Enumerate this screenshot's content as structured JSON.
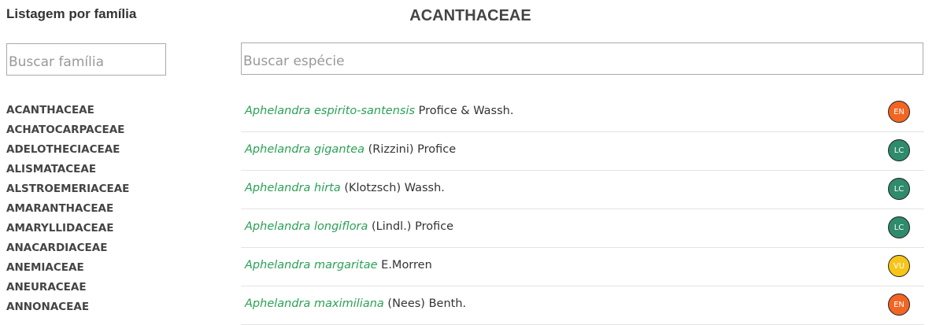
{
  "sidebar": {
    "title": "Listagem por família",
    "search_placeholder": "Buscar família",
    "families": [
      "ACANTHACEAE",
      "ACHATOCARPACEAE",
      "ADELOTHECIACEAE",
      "ALISMATACEAE",
      "ALSTROEMERIACEAE",
      "AMARANTHACEAE",
      "AMARYLLIDACEAE",
      "ANACARDIACEAE",
      "ANEMIACEAE",
      "ANEURACEAE",
      "ANNONACEAE"
    ]
  },
  "main": {
    "title": "ACANTHACEAE",
    "search_placeholder": "Buscar espécie",
    "species": [
      {
        "name": "Aphelandra espirito-santensis",
        "author": "Profice & Wassh.",
        "status": "EN",
        "status_color": "#f26522"
      },
      {
        "name": "Aphelandra gigantea",
        "author": "(Rizzini) Profice",
        "status": "LC",
        "status_color": "#2e8b6b"
      },
      {
        "name": "Aphelandra hirta",
        "author": "(Klotzsch) Wassh.",
        "status": "LC",
        "status_color": "#2e8b6b"
      },
      {
        "name": "Aphelandra longiflora",
        "author": "(Lindl.) Profice",
        "status": "LC",
        "status_color": "#2e8b6b"
      },
      {
        "name": "Aphelandra margaritae",
        "author": "E.Morren",
        "status": "VU",
        "status_color": "#f5c518"
      },
      {
        "name": "Aphelandra maximiliana",
        "author": "(Nees) Benth.",
        "status": "EN",
        "status_color": "#f26522"
      }
    ]
  },
  "colors": {
    "species_name": "#2aa155",
    "text": "#333333",
    "divider": "#e3e3e3"
  }
}
